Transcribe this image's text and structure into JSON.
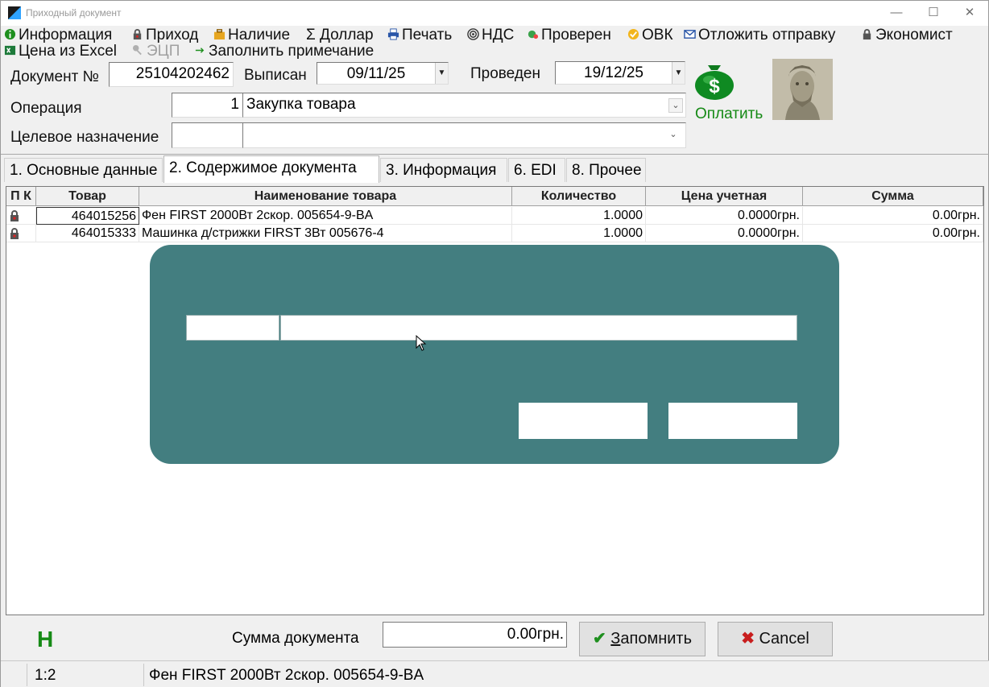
{
  "window": {
    "title": "Приходный документ",
    "minimize": "—",
    "maximize": "☐",
    "close": "✕"
  },
  "menu": {
    "row1": [
      {
        "label": "Информация",
        "icon": "info-icon"
      },
      {
        "label": "Приход",
        "icon": "lock-icon"
      },
      {
        "label": "Наличие",
        "icon": "briefcase-icon"
      },
      {
        "label": "Доллар",
        "icon": "sigma-icon"
      },
      {
        "label": "Печать",
        "icon": "printer-icon"
      },
      {
        "label": "НДС",
        "icon": "target-icon"
      },
      {
        "label": "Проверен",
        "icon": "check-gear-icon"
      },
      {
        "label": "ОВК",
        "icon": "ok-badge-icon"
      },
      {
        "label": "Отложить отправку",
        "icon": "envelope-icon"
      },
      {
        "label": "Экономист",
        "icon": "lock-icon"
      }
    ],
    "row2": [
      {
        "label": "Цена из Excel",
        "icon": "excel-icon"
      },
      {
        "label": "ЭЦП",
        "icon": "key-icon",
        "disabled": true
      },
      {
        "label": "Заполнить примечание",
        "icon": "arrow-icon"
      }
    ]
  },
  "header": {
    "doc_no_label": "Документ №",
    "doc_no": "25104202462",
    "issued_label": "Выписан",
    "issued_date": "09/11/25",
    "posted_label": "Проведен",
    "posted_date": "19/12/25",
    "operation_label": "Операция",
    "operation_code": "1",
    "operation_name": "Закупка товара",
    "purpose_label": "Целевое назначение",
    "purpose_code": "",
    "purpose_name": "",
    "pay_label": "Оплатить"
  },
  "tabs": [
    {
      "label": "1. Основные данные",
      "active": false
    },
    {
      "label": "2. Содержимое документа",
      "active": true
    },
    {
      "label": "3. Информация",
      "active": false
    },
    {
      "label": "6. EDI",
      "active": false
    },
    {
      "label": "8. Прочее",
      "active": false
    }
  ],
  "grid": {
    "columns": [
      "П К",
      "Товар",
      "Наименование товара",
      "Количество",
      "Цена учетная",
      "Сумма"
    ],
    "rows": [
      {
        "code": "464015256",
        "name": "Фен FIRST 2000Вт 2скор. 005654-9-BA",
        "qty": "1.0000",
        "price": "0.0000грн.",
        "sum": "0.00грн."
      },
      {
        "code": "464015333",
        "name": "Машинка д/стрижки FIRST 3Вт 005676-4",
        "qty": "1.0000",
        "price": "0.0000грн.",
        "sum": "0.00грн."
      }
    ]
  },
  "footer": {
    "mark": "Н",
    "sum_label": "Сумма документа",
    "sum_value": "0.00грн.",
    "save_prefix": "З",
    "save_rest": "апомнить",
    "cancel_label": "Cancel"
  },
  "status": {
    "position": "1:2",
    "current_item": "Фен FIRST 2000Вт 2скор. 005654-9-BA"
  },
  "colors": {
    "dialog_bg": "#437e80",
    "pay_green": "#168a16"
  }
}
